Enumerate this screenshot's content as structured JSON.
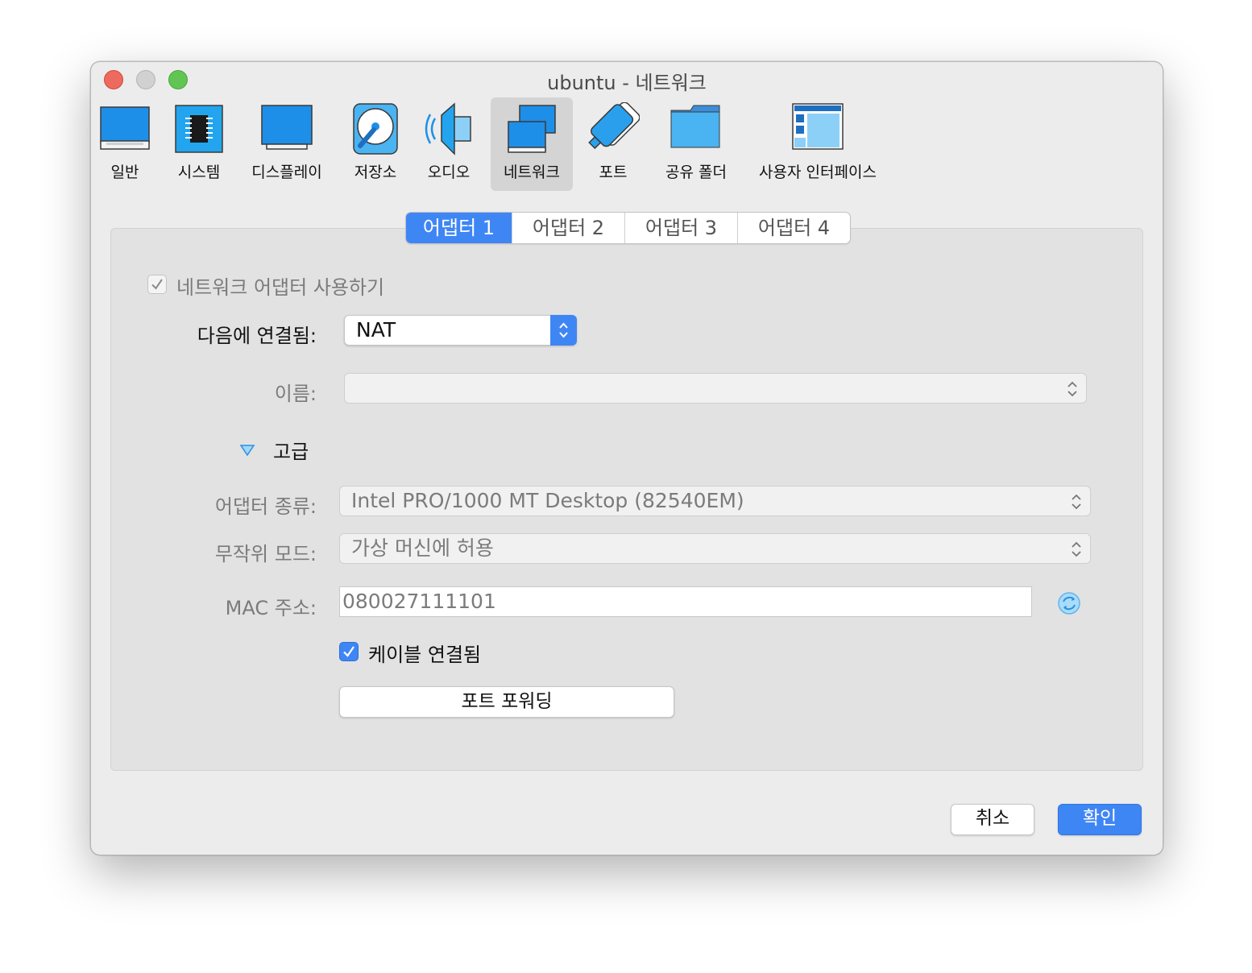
{
  "window": {
    "title": "ubuntu - 네트워크"
  },
  "toolbar": {
    "items": [
      {
        "label": "일반"
      },
      {
        "label": "시스템"
      },
      {
        "label": "디스플레이"
      },
      {
        "label": "저장소"
      },
      {
        "label": "오디오"
      },
      {
        "label": "네트워크"
      },
      {
        "label": "포트"
      },
      {
        "label": "공유 폴더"
      },
      {
        "label": "사용자 인터페이스"
      }
    ],
    "selected": "네트워크"
  },
  "tabs": [
    {
      "label": "어댑터 1"
    },
    {
      "label": "어댑터 2"
    },
    {
      "label": "어댑터 3"
    },
    {
      "label": "어댑터 4"
    }
  ],
  "active_tab": "어댑터 1",
  "form": {
    "enable_adapter": {
      "label": "네트워크 어댑터 사용하기",
      "checked": true,
      "disabled": true
    },
    "attached_to": {
      "label": "다음에 연결됨:",
      "value": "NAT"
    },
    "name": {
      "label": "이름:",
      "value": ""
    },
    "advanced": {
      "label": "고급",
      "expanded": true
    },
    "adapter_type": {
      "label": "어댑터 종류:",
      "value": "Intel PRO/1000 MT Desktop (82540EM)"
    },
    "promiscuous_mode": {
      "label": "무작위 모드:",
      "value": "가상 머신에 허용"
    },
    "mac_address": {
      "label": "MAC 주소:",
      "value": "080027111101"
    },
    "cable_connected": {
      "label": "케이블 연결됨",
      "checked": true
    },
    "port_forwarding": {
      "label": "포트 포워딩"
    }
  },
  "footer": {
    "cancel_label": "취소",
    "ok_label": "확인"
  },
  "colors": {
    "accent": "#3f86f5",
    "selected_toolbar_bg": "#d4d4d4"
  }
}
